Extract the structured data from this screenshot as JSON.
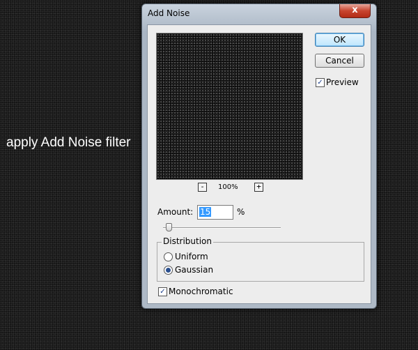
{
  "caption": "apply Add Noise filter",
  "dialog": {
    "title": "Add Noise",
    "close_glyph": "x",
    "ok_label": "OK",
    "cancel_label": "Cancel",
    "preview_label": "Preview",
    "preview_checked": true,
    "zoom_out": "-",
    "zoom_in": "+",
    "zoom_level": "100%",
    "amount_label": "Amount:",
    "amount_value": "15",
    "amount_unit": "%",
    "slider_level": 0.04,
    "distribution_legend": "Distribution",
    "uniform_label": "Uniform",
    "gaussian_label": "Gaussian",
    "selected_distribution": "Gaussian",
    "monochromatic_label": "Monochromatic",
    "monochromatic_checked": true,
    "check_glyph": "✓"
  }
}
